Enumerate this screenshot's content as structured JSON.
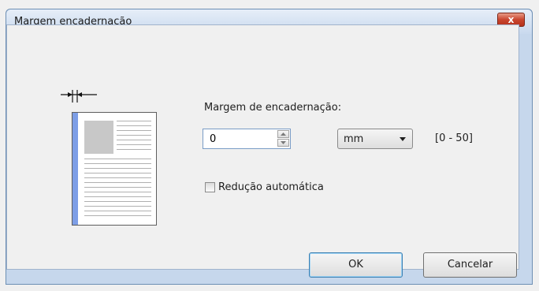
{
  "dialog": {
    "title": "Margem encadernação"
  },
  "form": {
    "margin_label": "Margem de encadernação:",
    "margin_value": "0",
    "unit_selected": "mm",
    "range_text": "[0 - 50]",
    "auto_reduce_label": "Redução automática",
    "auto_reduce_checked": false
  },
  "buttons": {
    "ok": "OK",
    "cancel": "Cancelar",
    "close": "x"
  },
  "colors": {
    "binding_edge": "#7d9ee6",
    "close_button": "#c9452e"
  }
}
